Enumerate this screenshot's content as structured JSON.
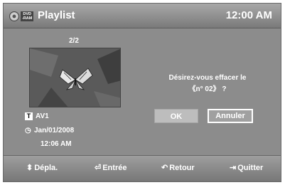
{
  "header": {
    "disc_badge_line1": "DVD",
    "disc_badge_line2": "-RAM",
    "title": "Playlist",
    "clock": "12:00 AM"
  },
  "item": {
    "counter": "2/2",
    "source": "AV1",
    "date": "Jan/01/2008",
    "time": "12:06 AM"
  },
  "dialog": {
    "question_line1": "Désirez-vous effacer le",
    "question_line2": "《n° 02》 ?",
    "ok_label": "OK",
    "cancel_label": "Annuler"
  },
  "footer": {
    "move_label": "Dépla.",
    "enter_label": "Entrée",
    "return_label": "Retour",
    "exit_label": "Quitter"
  }
}
